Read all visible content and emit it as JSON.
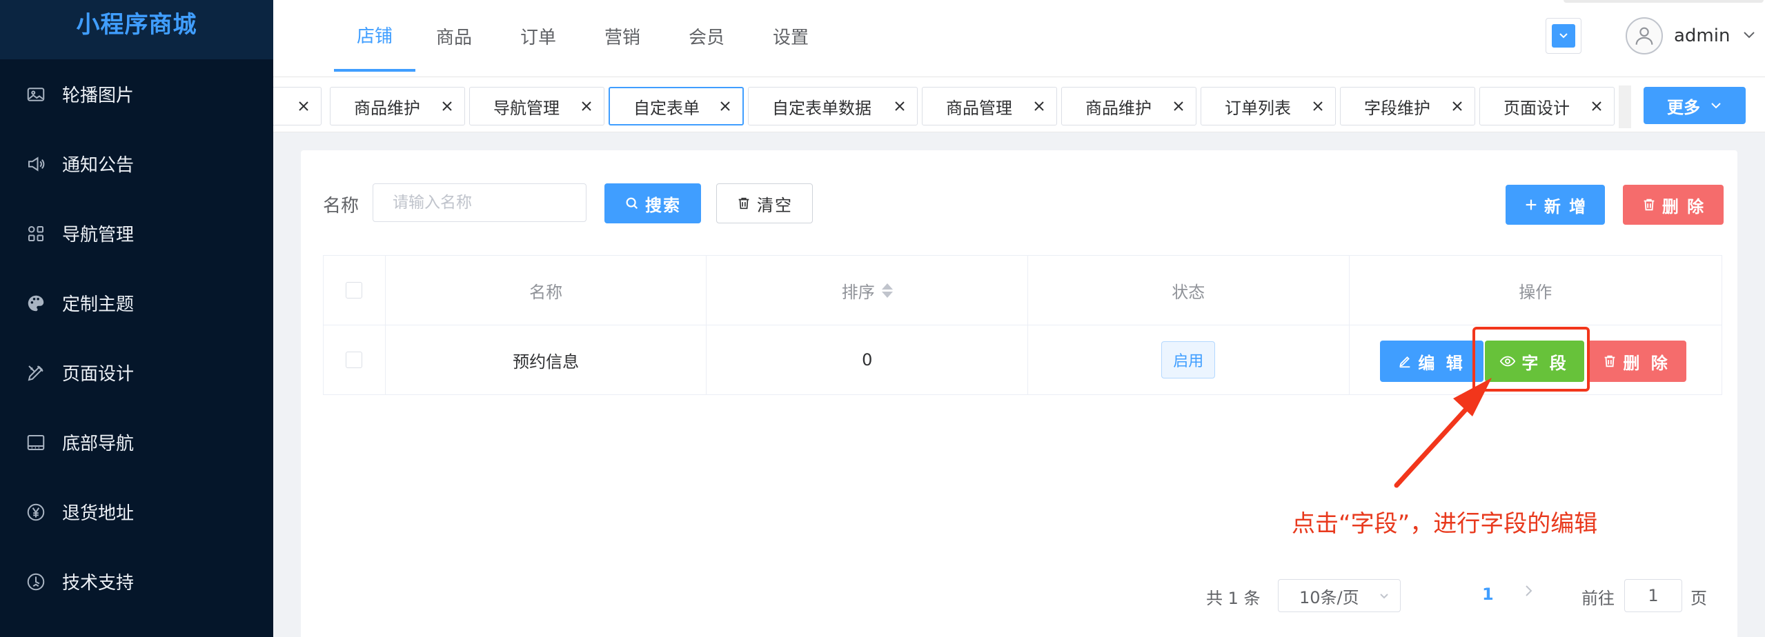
{
  "sidebar": {
    "title": "小程序商城",
    "items": [
      {
        "label": "轮播图片",
        "icon": "image-icon"
      },
      {
        "label": "通知公告",
        "icon": "speaker-icon"
      },
      {
        "label": "导航管理",
        "icon": "grid-icon"
      },
      {
        "label": "定制主题",
        "icon": "palette-icon"
      },
      {
        "label": "页面设计",
        "icon": "design-tools-icon"
      },
      {
        "label": "底部导航",
        "icon": "bottom-bar-icon"
      },
      {
        "label": "退货地址",
        "icon": "yen-icon"
      },
      {
        "label": "技术支持",
        "icon": "support-icon"
      }
    ]
  },
  "topnav": {
    "tabs": [
      "店铺",
      "商品",
      "订单",
      "营销",
      "会员",
      "设置"
    ],
    "active_tab": "店铺",
    "user": "admin"
  },
  "tags": {
    "items": [
      "商品维护",
      "导航管理",
      "自定表单",
      "自定表单数据",
      "商品管理",
      "商品维护",
      "订单列表",
      "字段维护",
      "页面设计"
    ],
    "active": "自定表单",
    "more_label": "更多"
  },
  "filter": {
    "name_label": "名称",
    "name_placeholder": "请输入名称",
    "search_label": "搜索",
    "clear_label": "清空",
    "add_label": "新 增",
    "delete_label": "删 除"
  },
  "table": {
    "headers": [
      "名称",
      "排序",
      "状态",
      "操作"
    ],
    "rows": [
      {
        "name": "预约信息",
        "sort": "0",
        "status": "启用"
      }
    ],
    "actions": {
      "edit": "编 辑",
      "field": "字 段",
      "delete": "删 除"
    }
  },
  "pagination": {
    "total": "共 1 条",
    "page_size": "10条/页",
    "current_page": "1",
    "goto_label": "前往",
    "goto_value": "1",
    "page_suffix": "页"
  },
  "annotation": {
    "text": "点击“字段”，进行字段的编辑",
    "color": "#e8391d"
  },
  "colors": {
    "primary": "#409eff",
    "success": "#67c23a",
    "danger": "#f56c6c",
    "sidebar_bg": "#05162a"
  }
}
